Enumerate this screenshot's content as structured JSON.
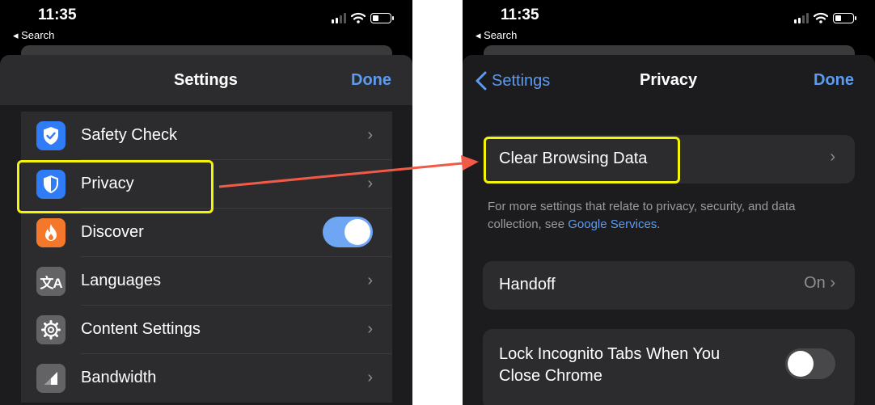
{
  "status_bar": {
    "time": "11:35",
    "back_label": "◂ Search"
  },
  "settings": {
    "title": "Settings",
    "done_label": "Done",
    "items": [
      {
        "label": "Safety Check",
        "icon": "shield-check-icon",
        "color": "#2f7cf6",
        "accessory": "chevron"
      },
      {
        "label": "Privacy",
        "icon": "shield-icon",
        "color": "#2f7cf6",
        "accessory": "chevron"
      },
      {
        "label": "Discover",
        "icon": "flame-icon",
        "color": "#f5782a",
        "accessory": "toggle",
        "toggle_on": true
      },
      {
        "label": "Languages",
        "icon": "translate-icon",
        "color": "#636366",
        "accessory": "chevron"
      },
      {
        "label": "Content Settings",
        "icon": "gear-icon",
        "color": "#636366",
        "accessory": "chevron"
      },
      {
        "label": "Bandwidth",
        "icon": "signal-icon",
        "color": "#636366",
        "accessory": "chevron"
      }
    ]
  },
  "privacy": {
    "back_label": "Settings",
    "title": "Privacy",
    "done_label": "Done",
    "clear_browsing_data": "Clear Browsing Data",
    "note_text": "For more settings that relate to privacy, security, and data collection, see ",
    "note_link": "Google Services",
    "note_end": ".",
    "handoff_label": "Handoff",
    "handoff_value": "On",
    "lock_label_line1": "Lock Incognito Tabs When You",
    "lock_label_line2": "Close Chrome",
    "lock_toggle_on": false
  },
  "colors": {
    "accent_blue": "#5c9bf0",
    "highlight_yellow": "#f4f40a",
    "arrow_red": "#f05a46",
    "toggle_on": "#6ea6f4",
    "toggle_off": "#48484a"
  }
}
